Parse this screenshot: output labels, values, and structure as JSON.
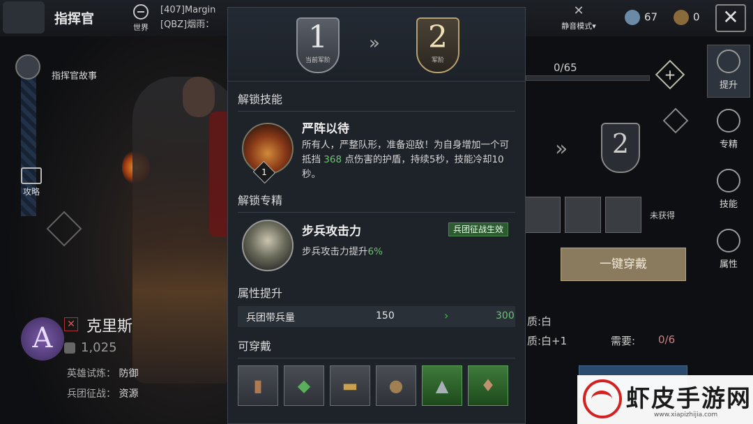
{
  "header": {
    "title": "指挥官",
    "world_label": "世界",
    "chat_lines": [
      "[407]Margin",
      "[QBZ]烟雨："
    ],
    "mute_label": "静音模式▾",
    "resource_1": "67",
    "resource_2": "0",
    "close_label": "✕"
  },
  "left": {
    "story_label": "指挥官故事",
    "guide_label": "攻略",
    "rank_letter": "A",
    "hero_name": "克里斯",
    "power": "1,025",
    "trial_label": "英雄试炼：",
    "trial_value": "防御",
    "camp_label": "兵团征战：",
    "camp_value": "资源"
  },
  "right": {
    "progress": "0/65",
    "tab_upgrade": "提升",
    "tab_spec": "专精",
    "tab_skill": "技能",
    "tab_attr": "属性",
    "next_rank": "2",
    "unequipped": "未获得",
    "equip_all": "一键穿戴",
    "quality_1": "质:白",
    "quality_2": "质:白+1",
    "need_label": "需要:",
    "need_value": "0/6"
  },
  "modal": {
    "current_rank": "1",
    "current_rank_caption": "当前军阶",
    "next_rank": "2",
    "next_rank_caption": "军阶",
    "unlock_skill_title": "解锁技能",
    "skill": {
      "name": "严阵以待",
      "level": "1",
      "desc_pre": "所有人，严整队形，准备迎敌！为自身增加一个可抵挡 ",
      "desc_value": "368",
      "desc_post": " 点伤害的护盾，持续5秒，技能冷却10秒。"
    },
    "unlock_spec_title": "解锁专精",
    "spec": {
      "name": "步兵攻击力",
      "badge": "兵团征战生效",
      "desc_pre": "步兵攻击力提升",
      "desc_value": "6%"
    },
    "attr_title": "属性提升",
    "attr": {
      "name": "兵团带兵量",
      "current": "150",
      "arrow": "›",
      "new": "300"
    },
    "wearable_title": "可穿戴",
    "wearables": [
      {
        "icon": "bracer-icon",
        "quality": "gray"
      },
      {
        "icon": "amulet-icon",
        "quality": "gray"
      },
      {
        "icon": "belt-icon",
        "quality": "gray"
      },
      {
        "icon": "shield-icon",
        "quality": "gray"
      },
      {
        "icon": "helmet-icon",
        "quality": "green"
      },
      {
        "icon": "armor-icon",
        "quality": "green"
      }
    ]
  },
  "watermark": {
    "title": "虾皮手游网",
    "url": "www.xiapizhijia.com"
  }
}
